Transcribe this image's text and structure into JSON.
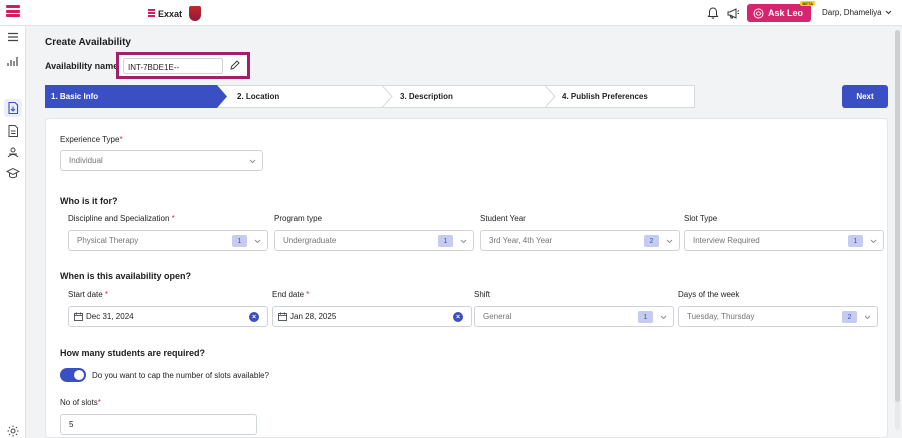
{
  "header": {
    "brand": "Exxat",
    "ask_leo": "Ask Leo",
    "beta": "BETA",
    "user_name": "Darp, Dhameliya"
  },
  "page": {
    "title": "Create Availability",
    "availability_name_label": "Availability name:",
    "availability_name_value": "INT-7BDE1E--"
  },
  "stepper": {
    "steps": [
      "1.  Basic Info",
      "2.  Location",
      "3.  Description",
      "4.  Publish Preferences"
    ],
    "active_index": 0,
    "next_label": "Next"
  },
  "form": {
    "experience_type_label": "Experience Type",
    "experience_type_value": "Individual",
    "who_section": "Who is it for?",
    "discipline_label": "Discipline and Specialization ",
    "discipline_value": "Physical Therapy",
    "discipline_count": "1",
    "program_type_label": "Program type",
    "program_type_value": "Undergraduate",
    "program_type_count": "1",
    "student_year_label": "Student Year",
    "student_year_value": "3rd Year, 4th Year",
    "student_year_count": "2",
    "slot_type_label": "Slot Type",
    "slot_type_value": "Interview Required",
    "slot_type_count": "1",
    "when_section": "When is this availability open?",
    "start_date_label": "Start date ",
    "start_date_value": "Dec 31, 2024",
    "end_date_label": "End date ",
    "end_date_value": "Jan 28, 2025",
    "shift_label": "Shift",
    "shift_value": "General",
    "shift_count": "1",
    "days_label": "Days of the week",
    "days_value": "Tuesday, Thursday",
    "days_count": "2",
    "students_section": "How many students are required?",
    "cap_toggle_label": "Do you want to cap the number of slots available?",
    "cap_toggle_on": true,
    "slots_label": "No of slots",
    "slots_value": "5",
    "required_mark": "*"
  },
  "colors": {
    "accent": "#3a4fc4",
    "brand": "#d6246e",
    "highlight_border": "#a0206e"
  }
}
